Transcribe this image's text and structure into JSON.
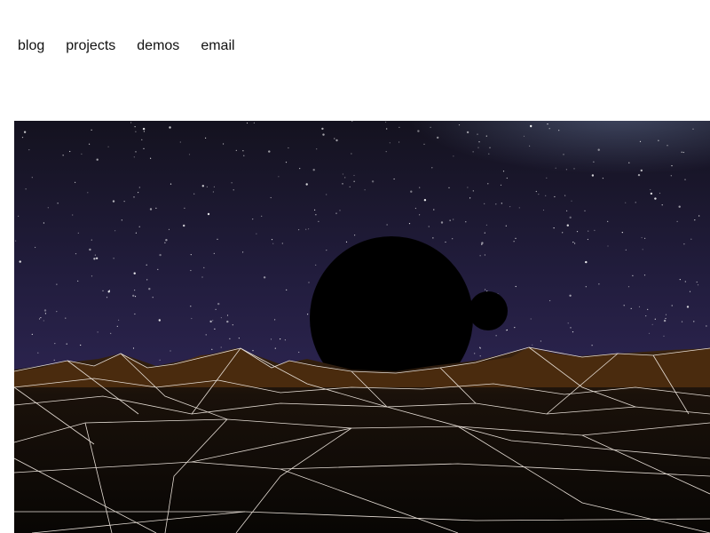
{
  "nav": {
    "items": [
      {
        "label": "blog"
      },
      {
        "label": "projects"
      },
      {
        "label": "demos"
      },
      {
        "label": "email"
      }
    ]
  },
  "scene": {
    "colors": {
      "sky_top": "#1c1a30",
      "sky_bottom": "#2a2450",
      "terrain_far": "#4a2a0a",
      "terrain_near": "#0b0806",
      "wire": "#e8e0d8",
      "planet": "#000000"
    }
  }
}
